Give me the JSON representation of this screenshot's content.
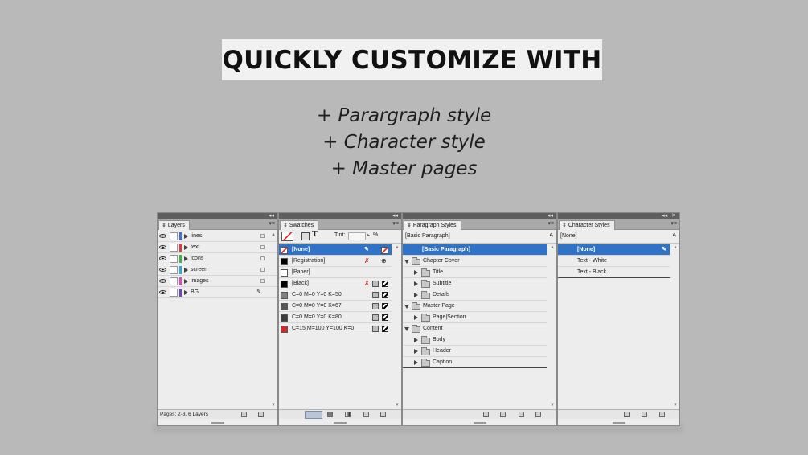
{
  "headline": "QUICKLY CUSTOMIZE WITH",
  "subtitles": [
    "+ Parargraph style",
    "+ Character style",
    "+ Master pages"
  ],
  "layers": {
    "tab": "Layers",
    "items": [
      {
        "name": "lines",
        "color": "#3f6fd6"
      },
      {
        "name": "text",
        "color": "#d63f3f"
      },
      {
        "name": "icons",
        "color": "#3fb34a"
      },
      {
        "name": "screen",
        "color": "#3aa7d0"
      },
      {
        "name": "images",
        "color": "#d14fb0"
      },
      {
        "name": "BG",
        "color": "#6b46c1"
      }
    ],
    "status": "Pages: 2-3, 6 Layers"
  },
  "swatches": {
    "tab": "Swatches",
    "tint_label": "Tint:",
    "tint_value": "",
    "tint_unit": "%",
    "items": [
      {
        "name": "[None]",
        "color": "none",
        "selected": true
      },
      {
        "name": "[Registration]",
        "color": "#000000"
      },
      {
        "name": "[Paper]",
        "color": "#ffffff"
      },
      {
        "name": "[Black]",
        "color": "#000000"
      },
      {
        "name": "C=0 M=0 Y=0 K=50",
        "color": "#808080"
      },
      {
        "name": "C=0 M=0 Y=0 K=67",
        "color": "#565656"
      },
      {
        "name": "C=0 M=0 Y=0 K=80",
        "color": "#3b3b3b"
      },
      {
        "name": "C=15 M=100 Y=100 K=0",
        "color": "#d22a2a"
      }
    ]
  },
  "paragraph_styles": {
    "tab": "Paragraph Styles",
    "current": "[Basic Paragraph]",
    "items": [
      {
        "name": "[Basic Paragraph]",
        "level": 0,
        "type": "style",
        "selected": true
      },
      {
        "name": "Chapter Cover",
        "level": 0,
        "type": "group-open"
      },
      {
        "name": "Title",
        "level": 1,
        "type": "group"
      },
      {
        "name": "Subtitle",
        "level": 1,
        "type": "group"
      },
      {
        "name": "Details",
        "level": 1,
        "type": "group"
      },
      {
        "name": "Master Page",
        "level": 0,
        "type": "group-open"
      },
      {
        "name": "Page|Section",
        "level": 1,
        "type": "group"
      },
      {
        "name": "Content",
        "level": 0,
        "type": "group-open"
      },
      {
        "name": "Body",
        "level": 1,
        "type": "group"
      },
      {
        "name": "Header",
        "level": 1,
        "type": "group"
      },
      {
        "name": "Caption",
        "level": 1,
        "type": "group"
      }
    ]
  },
  "character_styles": {
    "tab": "Character Styles",
    "current": "[None]",
    "items": [
      {
        "name": "[None]",
        "selected": true
      },
      {
        "name": "Text - White"
      },
      {
        "name": "Text - Black"
      }
    ]
  }
}
